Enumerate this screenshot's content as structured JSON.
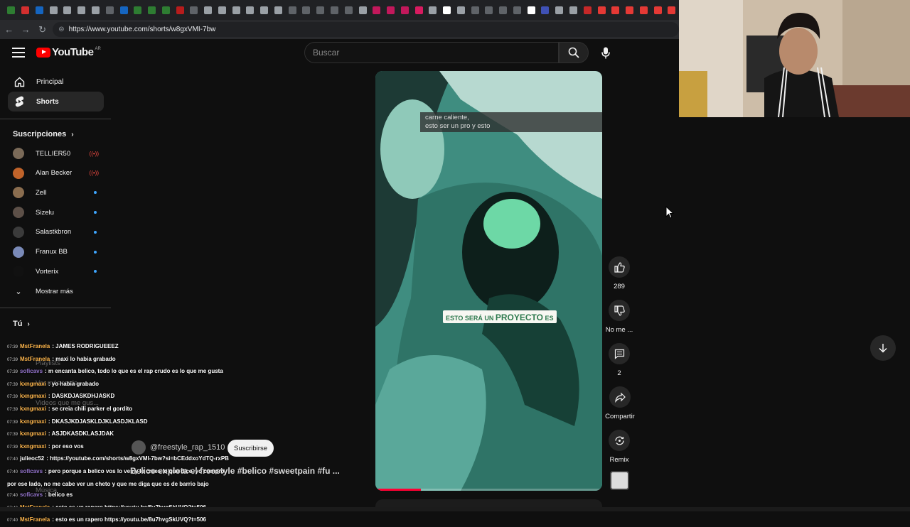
{
  "browser": {
    "url": "https://www.youtube.com/shorts/w8gxVMI-7bw",
    "tab_colors": [
      "#2e7d32",
      "#d32f2f",
      "#1565c0",
      "#9aa0a6",
      "#9aa0a6",
      "#9aa0a6",
      "#9aa0a6",
      "#5f6368",
      "#1565c0",
      "#2e7d32",
      "#2e7d32",
      "#2e7d32",
      "#b71c1c",
      "#5f6368",
      "#9aa0a6",
      "#9aa0a6",
      "#9aa0a6",
      "#9aa0a6",
      "#9aa0a6",
      "#9aa0a6",
      "#5f6368",
      "#5f6368",
      "#5f6368",
      "#5f6368",
      "#5f6368",
      "#9aa0a6",
      "#c2185b",
      "#c2185b",
      "#c2185b",
      "#d81b60",
      "#9aa0a6",
      "#ffffff",
      "#9aa0a6",
      "#5f6368",
      "#5f6368",
      "#5f6368",
      "#5f6368",
      "#ffffff",
      "#3f51b5",
      "#9aa0a6",
      "#9aa0a6",
      "#c62828",
      "#e53935",
      "#e53935",
      "#e53935",
      "#e53935",
      "#e53935",
      "#e53935"
    ]
  },
  "header": {
    "logo_text": "YouTube",
    "country_code": "AR",
    "search_placeholder": "Buscar"
  },
  "sidebar": {
    "nav": [
      {
        "label": "Principal",
        "icon": "home-icon"
      },
      {
        "label": "Shorts",
        "icon": "shorts-icon"
      }
    ],
    "subscriptions_title": "Suscripciones",
    "subscriptions": [
      {
        "name": "TELLIER50",
        "status": "live",
        "avatar": "#7a6a58"
      },
      {
        "name": "Alan Becker",
        "status": "live",
        "avatar": "#c0632a"
      },
      {
        "name": "Zell",
        "status": "new",
        "avatar": "#8a6d4f"
      },
      {
        "name": "Sizelu",
        "status": "new",
        "avatar": "#5d5048"
      },
      {
        "name": "Salastkbron",
        "status": "new",
        "avatar": "#3b3b3b"
      },
      {
        "name": "Franux BB",
        "status": "new",
        "avatar": "#7a8ab8"
      },
      {
        "name": "Vorterix",
        "status": "new",
        "avatar": "#111111"
      }
    ],
    "show_more": "Mostrar más",
    "you_title": "Tú",
    "you_items": [
      "Playlists",
      "Ver más tarde",
      "Videos que me gus...",
      "Música"
    ]
  },
  "short": {
    "caption_top": [
      "carne caliente,",
      "esto ser un pro y esto"
    ],
    "caption_mid_small": "ESTO SERÁ UN",
    "caption_mid_big": "PROYECTO",
    "caption_mid_end": "ES",
    "progress": 0.2,
    "channel_handle": "@freestyle_rap_1510",
    "subscribe_label": "Suscribirse",
    "title": "Belico explota el freestyle #belico #sweetpain #fu ..."
  },
  "actions": {
    "like_count": "289",
    "dislike_label": "No me ...",
    "comments_count": "2",
    "share_label": "Compartir",
    "remix_label": "Remix"
  },
  "chat": [
    {
      "time": "07:39",
      "user": "MstFranela",
      "color": "#ffb74d",
      "text": ": JAMES RODRIGUEEEZ"
    },
    {
      "time": "07:39",
      "user": "MstFranela",
      "color": "#ffb74d",
      "text": ": maxi lo habia grabado"
    },
    {
      "time": "07:39",
      "user": "soficavs",
      "color": "#9575cd",
      "text": ": m encanta belico, todo lo que es el rap crudo es lo que me gusta"
    },
    {
      "time": "07:39",
      "user": "kxngmaxi",
      "color": "#ffb74d",
      "text": ": yo habia grabado"
    },
    {
      "time": "07:39",
      "user": "kxngmaxi",
      "color": "#ffb74d",
      "text": ": DASKDJASKDHJASKD"
    },
    {
      "time": "07:39",
      "user": "kxngmaxi",
      "color": "#ffb74d",
      "text": ": se creia chili parker el gordito"
    },
    {
      "time": "07:39",
      "user": "kxngmaxi",
      "color": "#ffb74d",
      "text": ": DKASJKDJASKLDJKLASDJKLASD"
    },
    {
      "time": "07:39",
      "user": "kxngmaxi",
      "color": "#ffb74d",
      "text": ": ASJDKASDKLASJDAK"
    },
    {
      "time": "07:39",
      "user": "kxngmaxi",
      "color": "#ffb74d",
      "text": ": por eso vos"
    },
    {
      "time": "07:40",
      "user": "julieoc52",
      "color": "#ffffff",
      "text": ": https://youtube.com/shorts/w8gxVMI-7bw?si=bCEddxoYdTQ-rxPB"
    },
    {
      "time": "07:40",
      "user": "soficavs",
      "color": "#9575cd",
      "text": ": pero porque a belico vos lo ves y le crees lo que dice, yo compro por ese lado, no me cabe ver un cheto y que me diga que es de barrio bajo"
    },
    {
      "time": "07:40",
      "user": "soficavs",
      "color": "#9575cd",
      "text": ": belico es"
    },
    {
      "time": "07:40",
      "user": "MstFranela",
      "color": "#ffb74d",
      "text": ": esto es un rapero https://youtu.be/8u7hvgSkUVQ?t=506"
    },
    {
      "time": "07:40",
      "user": "MstFranela",
      "color": "#ffb74d",
      "text": ": esto es un rapero https://youtu.be/8u7hvgSkUVQ?t=506"
    }
  ]
}
